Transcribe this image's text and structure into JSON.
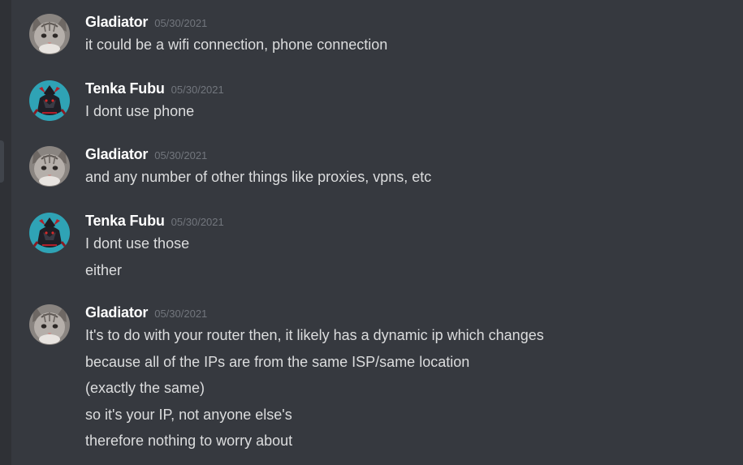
{
  "messages": [
    {
      "author": "Gladiator",
      "timestamp": "05/30/2021",
      "avatar": "cat-avatar",
      "lines": [
        "it could be a wifi connection, phone connection"
      ]
    },
    {
      "author": "Tenka Fubu",
      "timestamp": "05/30/2021",
      "avatar": "samurai-avatar",
      "lines": [
        "I dont use phone"
      ]
    },
    {
      "author": "Gladiator",
      "timestamp": "05/30/2021",
      "avatar": "cat-avatar",
      "lines": [
        "and any number of other things like proxies, vpns, etc"
      ]
    },
    {
      "author": "Tenka Fubu",
      "timestamp": "05/30/2021",
      "avatar": "samurai-avatar",
      "lines": [
        "I dont use those",
        "either"
      ]
    },
    {
      "author": "Gladiator",
      "timestamp": "05/30/2021",
      "avatar": "cat-avatar",
      "lines": [
        "It's to do with your router then, it likely has a dynamic ip which changes",
        "because all of the IPs are from the same ISP/same location",
        "(exactly the same)",
        "so it's your IP, not anyone else's",
        "therefore nothing to worry about"
      ]
    }
  ],
  "colors": {
    "background": "#36393f",
    "username": "#ffffff",
    "timestamp": "#72767d",
    "message_text": "#dcddde",
    "samurai_avatar_bg": "#2fa3b5"
  }
}
